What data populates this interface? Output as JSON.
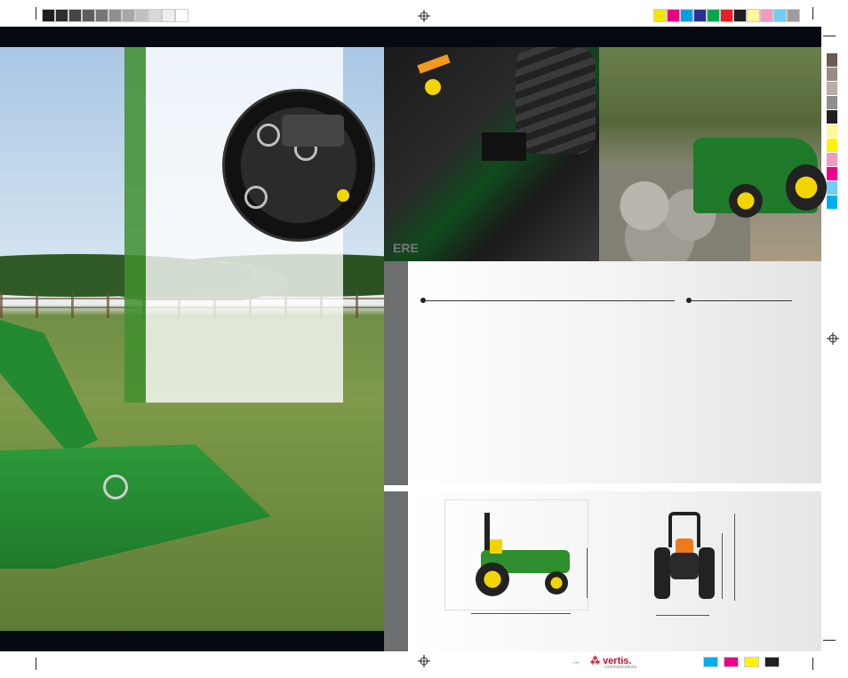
{
  "colors": {
    "jd_green": "#3f8f2f",
    "jd_yellow": "#f2d500",
    "dark_band": "#050a12",
    "rail_grey": "#6d6e70"
  },
  "print_marks": {
    "grey_bar": [
      "#1e1e1e",
      "#2e2e2e",
      "#454545",
      "#5d5d5d",
      "#777777",
      "#8f8f8f",
      "#a8a8a8",
      "#c0c0c0",
      "#d8d8d8",
      "#efefef",
      "#ffffff"
    ],
    "color_bar": [
      "#f7e500",
      "#e5007e",
      "#00a0e3",
      "#2e3192",
      "#00a651",
      "#ed1c24",
      "#231f20",
      "#fff799",
      "#f49ac1",
      "#6dcff6",
      "#9d9d9d"
    ],
    "bottom_swatches": [
      "#00aeef",
      "#ec008c",
      "#fff200",
      "#231f20"
    ],
    "side_strip": [
      "#6b5a52",
      "#9a8b85",
      "#b5aeab",
      "#8d8f91",
      "#231f20",
      "#fff799",
      "#fff200",
      "#f49ac1",
      "#ec008c",
      "#6dcff6",
      "#00aeef"
    ]
  },
  "vendor": {
    "name": "vertis.",
    "tagline": "communications"
  },
  "decal": "ERE"
}
